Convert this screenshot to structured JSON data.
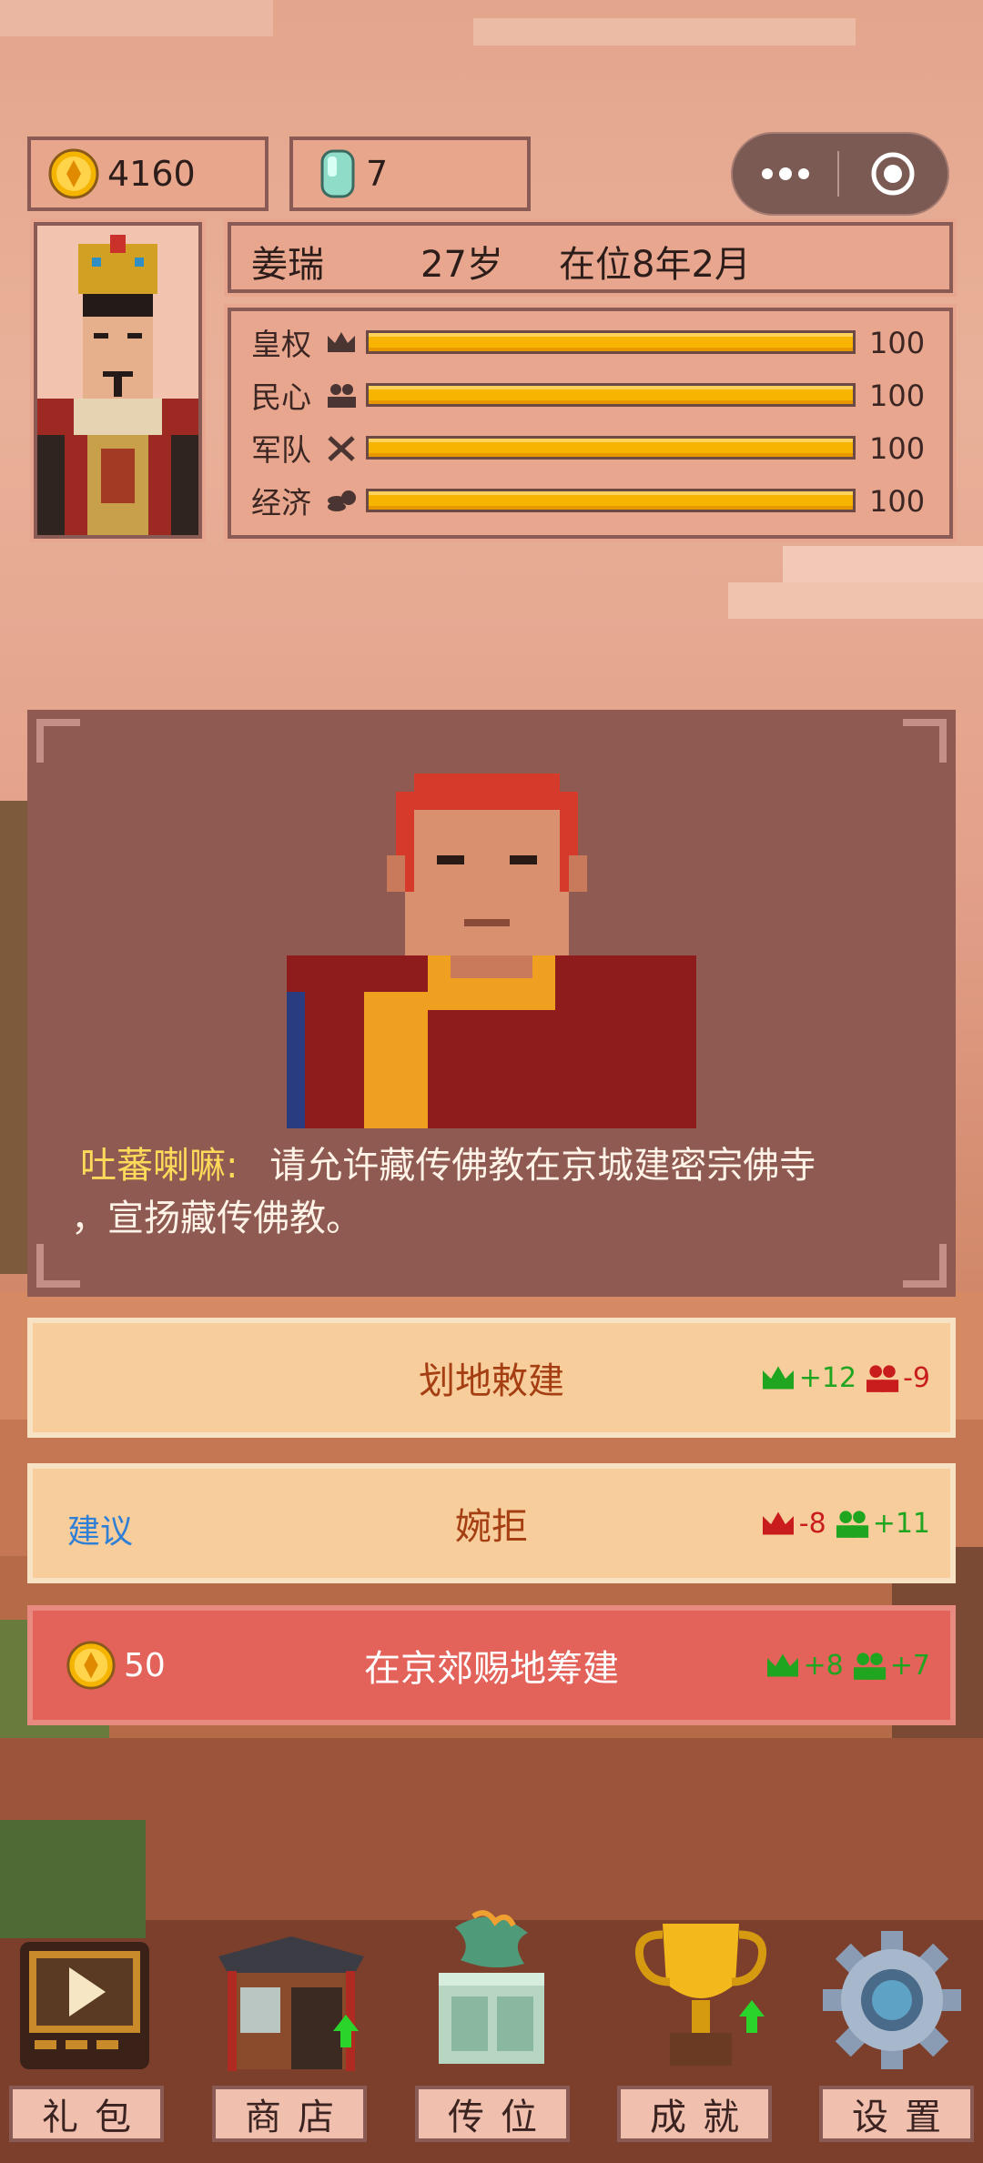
{
  "resources": {
    "gold": "4160",
    "jade": "7"
  },
  "ruler": {
    "name": "姜瑞",
    "age": "27岁",
    "reign": "在位8年2月"
  },
  "stats": [
    {
      "label": "皇权",
      "icon": "crown-icon",
      "value": "100",
      "level": 1.0
    },
    {
      "label": "民心",
      "icon": "people-icon",
      "value": "100",
      "level": 1.0
    },
    {
      "label": "军队",
      "icon": "swords-icon",
      "value": "100",
      "level": 1.0
    },
    {
      "label": "经济",
      "icon": "coins-icon",
      "value": "100",
      "level": 1.0
    }
  ],
  "event": {
    "speaker": "吐蕃喇嘛:",
    "text_line1": "请允许藏传佛教在京城建密宗佛寺",
    "text_line2": "，宣扬藏传佛教。"
  },
  "choices": [
    {
      "label": "划地敕建",
      "tag": "",
      "cost": "",
      "effect1": "+12",
      "effect2": "-9"
    },
    {
      "label": "婉拒",
      "tag": "建议",
      "cost": "",
      "effect1": "-8",
      "effect2": "+11"
    },
    {
      "label": "在京郊赐地筹建",
      "tag": "",
      "cost": "50",
      "effect1": "+8",
      "effect2": "+7"
    }
  ],
  "nav": [
    {
      "label": "礼包",
      "icon": "video-play-icon"
    },
    {
      "label": "商店",
      "icon": "shop-icon"
    },
    {
      "label": "传位",
      "icon": "jade-seal-icon"
    },
    {
      "label": "成就",
      "icon": "trophy-icon"
    },
    {
      "label": "设置",
      "icon": "gear-icon"
    }
  ],
  "colors": {
    "gain": "#1fa51f",
    "loss": "#c91d1d",
    "bar": "#f7b400",
    "suggest": "#2f7fd6"
  }
}
